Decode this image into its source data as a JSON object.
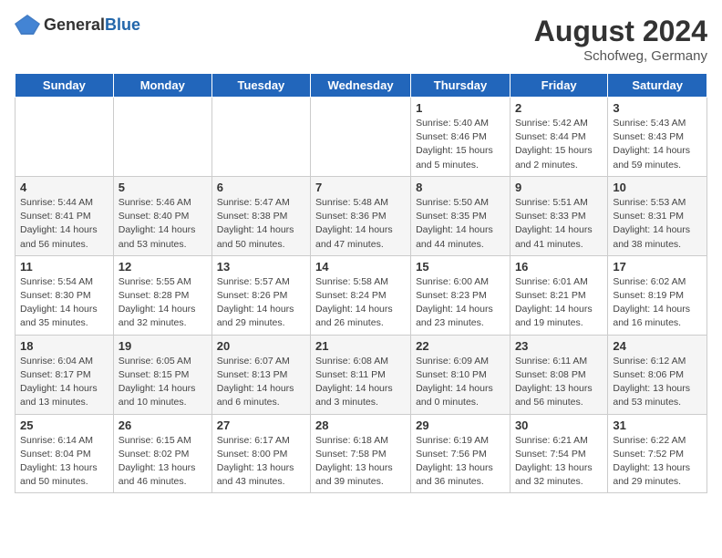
{
  "header": {
    "logo_general": "General",
    "logo_blue": "Blue",
    "month_year": "August 2024",
    "location": "Schofweg, Germany"
  },
  "weekdays": [
    "Sunday",
    "Monday",
    "Tuesday",
    "Wednesday",
    "Thursday",
    "Friday",
    "Saturday"
  ],
  "weeks": [
    [
      {
        "day": "",
        "detail": ""
      },
      {
        "day": "",
        "detail": ""
      },
      {
        "day": "",
        "detail": ""
      },
      {
        "day": "",
        "detail": ""
      },
      {
        "day": "1",
        "detail": "Sunrise: 5:40 AM\nSunset: 8:46 PM\nDaylight: 15 hours\nand 5 minutes."
      },
      {
        "day": "2",
        "detail": "Sunrise: 5:42 AM\nSunset: 8:44 PM\nDaylight: 15 hours\nand 2 minutes."
      },
      {
        "day": "3",
        "detail": "Sunrise: 5:43 AM\nSunset: 8:43 PM\nDaylight: 14 hours\nand 59 minutes."
      }
    ],
    [
      {
        "day": "4",
        "detail": "Sunrise: 5:44 AM\nSunset: 8:41 PM\nDaylight: 14 hours\nand 56 minutes."
      },
      {
        "day": "5",
        "detail": "Sunrise: 5:46 AM\nSunset: 8:40 PM\nDaylight: 14 hours\nand 53 minutes."
      },
      {
        "day": "6",
        "detail": "Sunrise: 5:47 AM\nSunset: 8:38 PM\nDaylight: 14 hours\nand 50 minutes."
      },
      {
        "day": "7",
        "detail": "Sunrise: 5:48 AM\nSunset: 8:36 PM\nDaylight: 14 hours\nand 47 minutes."
      },
      {
        "day": "8",
        "detail": "Sunrise: 5:50 AM\nSunset: 8:35 PM\nDaylight: 14 hours\nand 44 minutes."
      },
      {
        "day": "9",
        "detail": "Sunrise: 5:51 AM\nSunset: 8:33 PM\nDaylight: 14 hours\nand 41 minutes."
      },
      {
        "day": "10",
        "detail": "Sunrise: 5:53 AM\nSunset: 8:31 PM\nDaylight: 14 hours\nand 38 minutes."
      }
    ],
    [
      {
        "day": "11",
        "detail": "Sunrise: 5:54 AM\nSunset: 8:30 PM\nDaylight: 14 hours\nand 35 minutes."
      },
      {
        "day": "12",
        "detail": "Sunrise: 5:55 AM\nSunset: 8:28 PM\nDaylight: 14 hours\nand 32 minutes."
      },
      {
        "day": "13",
        "detail": "Sunrise: 5:57 AM\nSunset: 8:26 PM\nDaylight: 14 hours\nand 29 minutes."
      },
      {
        "day": "14",
        "detail": "Sunrise: 5:58 AM\nSunset: 8:24 PM\nDaylight: 14 hours\nand 26 minutes."
      },
      {
        "day": "15",
        "detail": "Sunrise: 6:00 AM\nSunset: 8:23 PM\nDaylight: 14 hours\nand 23 minutes."
      },
      {
        "day": "16",
        "detail": "Sunrise: 6:01 AM\nSunset: 8:21 PM\nDaylight: 14 hours\nand 19 minutes."
      },
      {
        "day": "17",
        "detail": "Sunrise: 6:02 AM\nSunset: 8:19 PM\nDaylight: 14 hours\nand 16 minutes."
      }
    ],
    [
      {
        "day": "18",
        "detail": "Sunrise: 6:04 AM\nSunset: 8:17 PM\nDaylight: 14 hours\nand 13 minutes."
      },
      {
        "day": "19",
        "detail": "Sunrise: 6:05 AM\nSunset: 8:15 PM\nDaylight: 14 hours\nand 10 minutes."
      },
      {
        "day": "20",
        "detail": "Sunrise: 6:07 AM\nSunset: 8:13 PM\nDaylight: 14 hours\nand 6 minutes."
      },
      {
        "day": "21",
        "detail": "Sunrise: 6:08 AM\nSunset: 8:11 PM\nDaylight: 14 hours\nand 3 minutes."
      },
      {
        "day": "22",
        "detail": "Sunrise: 6:09 AM\nSunset: 8:10 PM\nDaylight: 14 hours\nand 0 minutes."
      },
      {
        "day": "23",
        "detail": "Sunrise: 6:11 AM\nSunset: 8:08 PM\nDaylight: 13 hours\nand 56 minutes."
      },
      {
        "day": "24",
        "detail": "Sunrise: 6:12 AM\nSunset: 8:06 PM\nDaylight: 13 hours\nand 53 minutes."
      }
    ],
    [
      {
        "day": "25",
        "detail": "Sunrise: 6:14 AM\nSunset: 8:04 PM\nDaylight: 13 hours\nand 50 minutes."
      },
      {
        "day": "26",
        "detail": "Sunrise: 6:15 AM\nSunset: 8:02 PM\nDaylight: 13 hours\nand 46 minutes."
      },
      {
        "day": "27",
        "detail": "Sunrise: 6:17 AM\nSunset: 8:00 PM\nDaylight: 13 hours\nand 43 minutes."
      },
      {
        "day": "28",
        "detail": "Sunrise: 6:18 AM\nSunset: 7:58 PM\nDaylight: 13 hours\nand 39 minutes."
      },
      {
        "day": "29",
        "detail": "Sunrise: 6:19 AM\nSunset: 7:56 PM\nDaylight: 13 hours\nand 36 minutes."
      },
      {
        "day": "30",
        "detail": "Sunrise: 6:21 AM\nSunset: 7:54 PM\nDaylight: 13 hours\nand 32 minutes."
      },
      {
        "day": "31",
        "detail": "Sunrise: 6:22 AM\nSunset: 7:52 PM\nDaylight: 13 hours\nand 29 minutes."
      }
    ]
  ]
}
